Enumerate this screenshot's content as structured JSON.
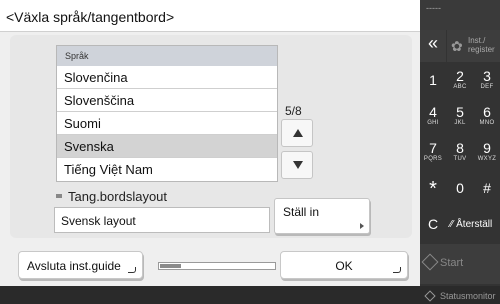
{
  "title": "<Växla språk/tangentbord>",
  "language_list": {
    "header": "Språk",
    "items": [
      "Slovenčina",
      "Slovenščina",
      "Suomi",
      "Svenska",
      "Tiếng Việt Nam"
    ],
    "selected": "Svenska"
  },
  "page_indicator": "5/8",
  "keyboard": {
    "label": "Tang.bordslayout",
    "value": "Svensk layout",
    "set_button": "Ställ in"
  },
  "bottom": {
    "exit_button": "Avsluta inst.guide",
    "ok_button": "OK",
    "progress_fraction": 0.18
  },
  "right_panel": {
    "top_dots": "-----",
    "back": "«",
    "settings": "Inst./ register",
    "settings_line1": "Inst./",
    "settings_line2": "register",
    "keys": [
      {
        "num": "1",
        "sub": ""
      },
      {
        "num": "2",
        "sub": "ABC"
      },
      {
        "num": "3",
        "sub": "DEF"
      },
      {
        "num": "4",
        "sub": "GHI"
      },
      {
        "num": "5",
        "sub": "JKL"
      },
      {
        "num": "6",
        "sub": "MNO"
      },
      {
        "num": "7",
        "sub": "PQRS"
      },
      {
        "num": "8",
        "sub": "TUV"
      },
      {
        "num": "9",
        "sub": "WXYZ"
      },
      {
        "num": "*",
        "sub": ""
      },
      {
        "num": "0",
        "sub": ""
      },
      {
        "num": "#",
        "sub": ""
      }
    ],
    "clear": "C",
    "reset": "Återställ",
    "start": "Start",
    "status_monitor": "Statusmonitor"
  },
  "colors": {
    "background": "#efefef",
    "dark_panel": "#333333",
    "selected_row": "#d3d3d3",
    "list_header": "#cfd3da"
  },
  "icons": [
    "gear-icon",
    "back-icon",
    "start-icon",
    "reset-icon",
    "status-monitor-icon",
    "scroll-up-icon",
    "scroll-down-icon"
  ]
}
